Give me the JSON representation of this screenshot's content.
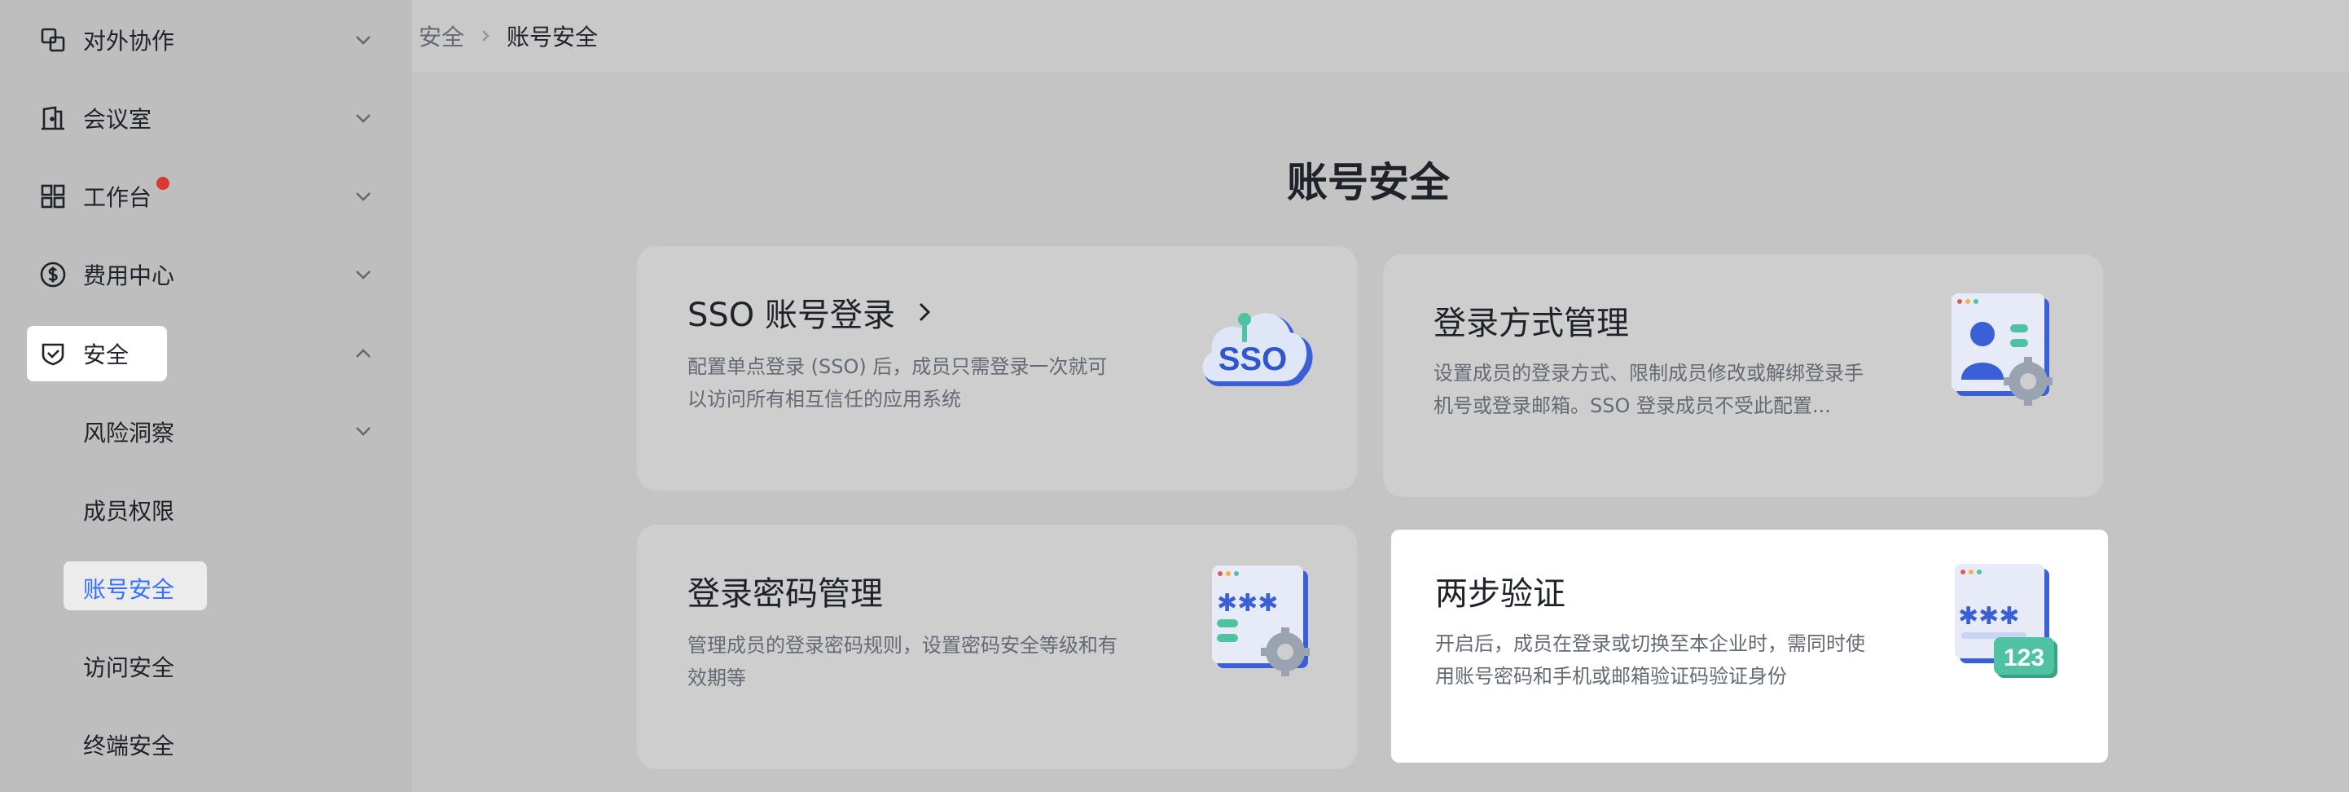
{
  "breadcrumb": {
    "parent": "安全",
    "current": "账号安全"
  },
  "sidebar": {
    "items": [
      {
        "label": "对外协作",
        "icon": "external-collab-icon"
      },
      {
        "label": "会议室",
        "icon": "meeting-room-icon"
      },
      {
        "label": "工作台",
        "icon": "workbench-grid-icon",
        "badge": true
      },
      {
        "label": "费用中心",
        "icon": "billing-dollar-icon"
      },
      {
        "label": "安全",
        "icon": "shield-check-icon",
        "expanded": true
      }
    ],
    "security_sub": [
      {
        "label": "风险洞察",
        "expandable": true
      },
      {
        "label": "成员权限"
      },
      {
        "label": "账号安全",
        "active": true
      },
      {
        "label": "访问安全"
      },
      {
        "label": "终端安全"
      }
    ]
  },
  "main": {
    "title": "账号安全",
    "cards": [
      {
        "title": "SSO 账号登录",
        "desc": "配置单点登录 (SSO) 后，成员只需登录一次就可以访问所有相互信任的应用系统",
        "icon": "sso-cloud-icon"
      },
      {
        "title": "登录方式管理",
        "desc": "设置成员的登录方式、限制成员修改或解绑登录手机号或登录邮箱。SSO 登录成员不受此配置...",
        "icon": "user-settings-icon"
      },
      {
        "title": "登录密码管理",
        "desc": "管理成员的登录密码规则，设置密码安全等级和有效期等",
        "icon": "password-settings-icon"
      },
      {
        "title": "两步验证",
        "desc": "开启后，成员在登录或切换至本企业时，需同时使用账号密码和手机或邮箱验证码验证身份",
        "icon": "two-step-123-icon",
        "badge_text": "123"
      }
    ]
  },
  "colors": {
    "accent": "#3370ff",
    "badge": "#d83931",
    "teal": "#4fc3a1"
  }
}
